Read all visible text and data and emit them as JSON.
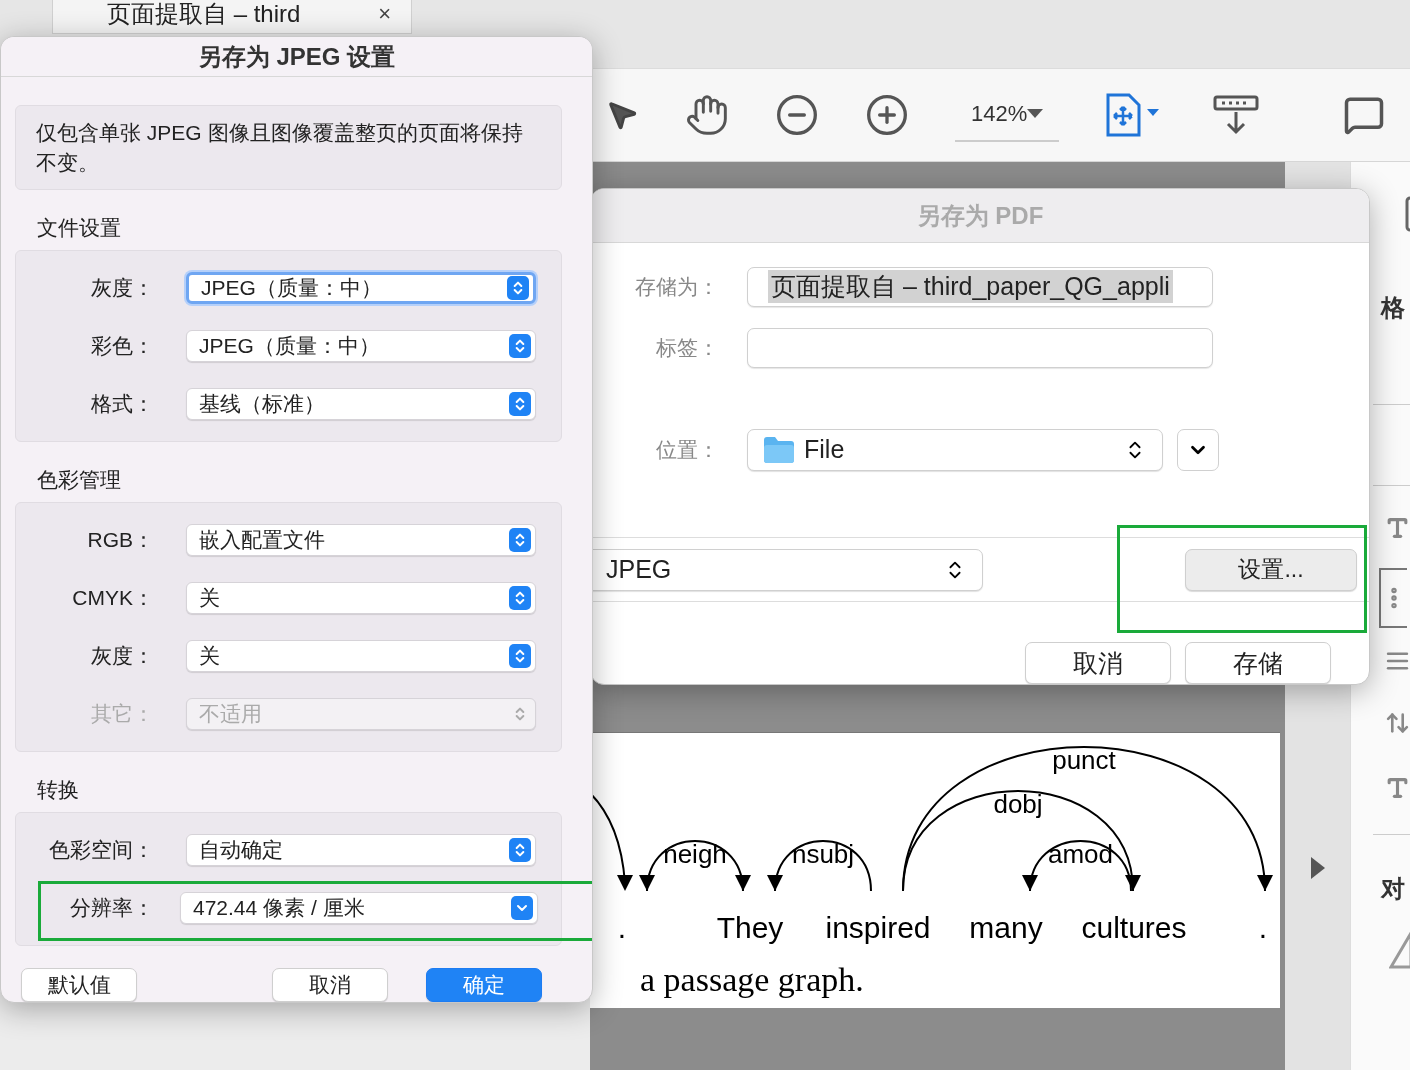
{
  "app_tab": {
    "title": "页面提取自 – third",
    "close": "×"
  },
  "toolbar": {
    "zoom": "142%"
  },
  "side_panel": {
    "labels": [
      "格",
      "对"
    ]
  },
  "document": {
    "words": [
      ".",
      "They",
      "inspired",
      "many",
      "cultures",
      "."
    ],
    "arcs": [
      {
        "label": "neigh"
      },
      {
        "label": "nsubj"
      },
      {
        "label": "punct"
      },
      {
        "label": "dobj"
      },
      {
        "label": "amod"
      }
    ],
    "caption": "a passage graph."
  },
  "pdf_dialog": {
    "title": "另存为 PDF",
    "active": false,
    "fields": [
      {
        "label": "存储为：",
        "value": "页面提取自 – third_paper_QG_appli",
        "kind": "text",
        "highlighted": true
      },
      {
        "label": "标签：",
        "kind": "text"
      },
      {
        "label": "位置：",
        "value": "File",
        "kind": "location"
      }
    ],
    "format": "JPEG",
    "settings_button": {
      "label": "设置...",
      "outlined": true
    },
    "buttons": [
      "取消",
      "存储"
    ]
  },
  "jpeg_dialog": {
    "title": "另存为 JPEG 设置",
    "note": "仅包含单张 JPEG 图像且图像覆盖整页的页面将保持不变。",
    "sections": [
      {
        "title": "文件设置",
        "rows": [
          {
            "label": "灰度：",
            "value": "JPEG（质量：中）",
            "kind": "popup",
            "focused": true,
            "disabled": false
          },
          {
            "label": "彩色：",
            "value": "JPEG（质量：中）",
            "kind": "popup",
            "focused": false,
            "disabled": false
          },
          {
            "label": "格式：",
            "value": "基线（标准）",
            "kind": "popup",
            "focused": false,
            "disabled": false
          }
        ]
      },
      {
        "title": "色彩管理",
        "rows": [
          {
            "label": "RGB：",
            "value": "嵌入配置文件",
            "kind": "popup",
            "focused": false,
            "disabled": false
          },
          {
            "label": "CMYK：",
            "value": "关",
            "kind": "popup",
            "focused": false,
            "disabled": false
          },
          {
            "label": "灰度：",
            "value": "关",
            "kind": "popup",
            "focused": false,
            "disabled": false
          },
          {
            "label": "其它：",
            "value": "不适用",
            "kind": "popup",
            "focused": false,
            "disabled": true
          }
        ]
      },
      {
        "title": "转换",
        "rows": [
          {
            "label": "色彩空间：",
            "value": "自动确定",
            "kind": "popup",
            "focused": false,
            "disabled": false
          },
          {
            "label": "分辨率：",
            "value": "472.44 像素 / 厘米",
            "kind": "combo",
            "focused": false,
            "disabled": false,
            "outlined": true
          }
        ]
      }
    ],
    "buttons": [
      {
        "label": "默认值",
        "primary": false
      },
      {
        "label": "取消",
        "primary": false
      },
      {
        "label": "确定",
        "primary": true
      }
    ]
  }
}
